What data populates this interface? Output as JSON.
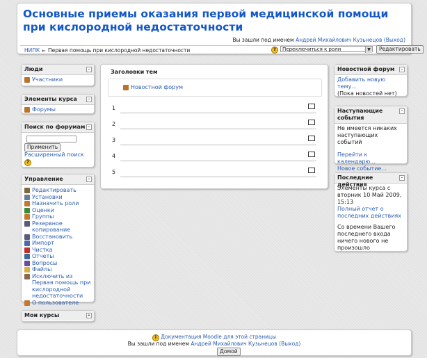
{
  "header": {
    "title": "Основные приемы оказания первой медицинской помощи при кислородной недостаточности",
    "login_prefix": "Вы зашли под именем",
    "user_name": "Андрей Михайлович Кузьнецов",
    "logout": "(Выход)",
    "breadcrumb": [
      "НИПК",
      "Первая помощь при кислородной недостаточности"
    ],
    "role_select": "Переключиться к роли",
    "edit_button": "Редактировать"
  },
  "left": {
    "people": {
      "title": "Люди",
      "items": [
        "Участники"
      ]
    },
    "elements": {
      "title": "Элементы курса",
      "items": [
        "Форумы"
      ]
    },
    "search": {
      "title": "Поиск по форумам",
      "apply_button": "Применить",
      "advanced": "Расширенный поиск"
    },
    "admin": {
      "title": "Управление",
      "items": [
        {
          "label": "Редактировать",
          "icon": "pencil-icon"
        },
        {
          "label": "Установки",
          "icon": "settings-icon"
        },
        {
          "label": "Назначить роли",
          "icon": "roles-icon"
        },
        {
          "label": "Оценки",
          "icon": "grades-icon"
        },
        {
          "label": "Группы",
          "icon": "groups-icon"
        },
        {
          "label": "Резервное копирование",
          "icon": "backup-icon"
        },
        {
          "label": "Восстановить",
          "icon": "restore-icon"
        },
        {
          "label": "Импорт",
          "icon": "import-icon"
        },
        {
          "label": "Чистка",
          "icon": "reset-icon"
        },
        {
          "label": "Отчеты",
          "icon": "reports-icon"
        },
        {
          "label": "Вопросы",
          "icon": "questions-icon"
        },
        {
          "label": "Файлы",
          "icon": "files-icon"
        },
        {
          "label": "Исключить из Первая помощь при кислородной недостаточности",
          "icon": "unenrol-icon"
        },
        {
          "label": "О пользователе",
          "icon": "profile-icon"
        }
      ]
    },
    "my_courses": {
      "title": "Мои курсы"
    }
  },
  "center": {
    "topics_title": "Заголовки тем",
    "forum_link": "Новостной форум",
    "topics": [
      "1",
      "2",
      "3",
      "4",
      "5"
    ]
  },
  "right": {
    "news": {
      "title": "Новостной форум",
      "add_link": "Добавить новую тему...",
      "no_news": "(Пока новостей нет)"
    },
    "upcoming": {
      "title": "Наступающие события",
      "text": "Не имеется никаких наступающих событий",
      "calendar_link": "Перейти к календарю...",
      "new_event_link": "Новое событие..."
    },
    "recent": {
      "title": "Последние действия",
      "since": "Элементы курса с вторник 10 Май 2009, 15:13",
      "report_link": "Полный отчет о последних действиях",
      "nothing": "Со времени Вашего последнего входа ничего нового не произошло"
    }
  },
  "footer": {
    "doc_link": "Документация Moodle для этой страницы",
    "login_prefix": "Вы зашли под именем",
    "user_name": "Андрей Михайлович Кузьнецов",
    "logout": "(Выход)",
    "home_button": "Домой"
  },
  "colors": {
    "link": "#2a5db0",
    "title": "#1458c8"
  }
}
